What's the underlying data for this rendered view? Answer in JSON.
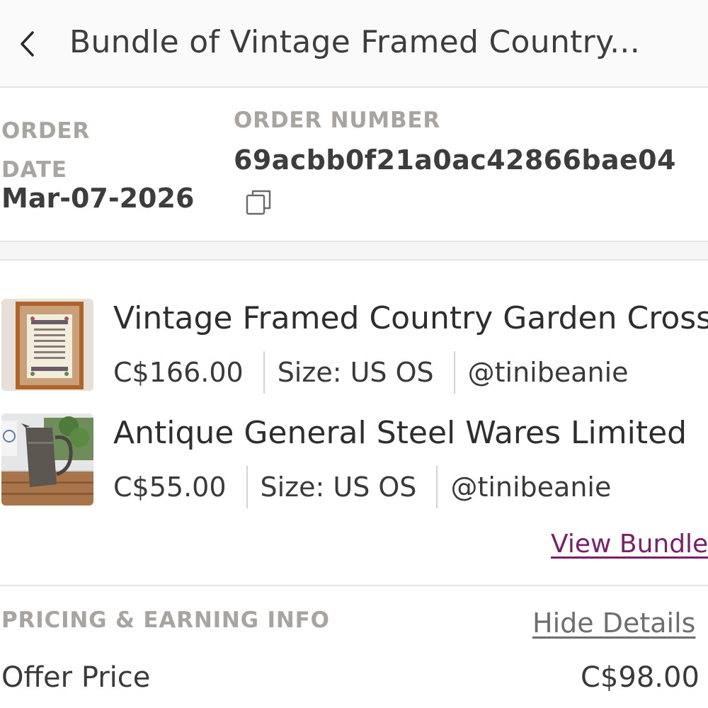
{
  "header": {
    "title": "Bundle of Vintage Framed Country..."
  },
  "order": {
    "date_label_line1": "ORDER",
    "date_label_line2": "DATE",
    "date_value": "Mar-07-2026",
    "number_label": "ORDER NUMBER",
    "number_value": "69acbb0f21a0ac42866bae04"
  },
  "items": [
    {
      "title": "Vintage Framed Country Garden Cross",
      "price": "C$166.00",
      "size": "Size: US OS",
      "seller": "@tinibeanie"
    },
    {
      "title": "Antique General Steel Wares Limited",
      "price": "C$55.00",
      "size": "Size: US OS",
      "seller": "@tinibeanie"
    }
  ],
  "bundle": {
    "view_label": "View Bundle"
  },
  "pricing": {
    "section_label": "PRICING & EARNING INFO",
    "toggle_label": "Hide Details",
    "offer_price_label": "Offer Price",
    "offer_price_value": "C$98.00"
  },
  "colors": {
    "accent_link": "#7a1f68",
    "label_gray": "#a8a4a0",
    "text_dark": "#3d3d3d"
  },
  "icons": {
    "back": "chevron-left-icon",
    "copy": "copy-icon"
  }
}
